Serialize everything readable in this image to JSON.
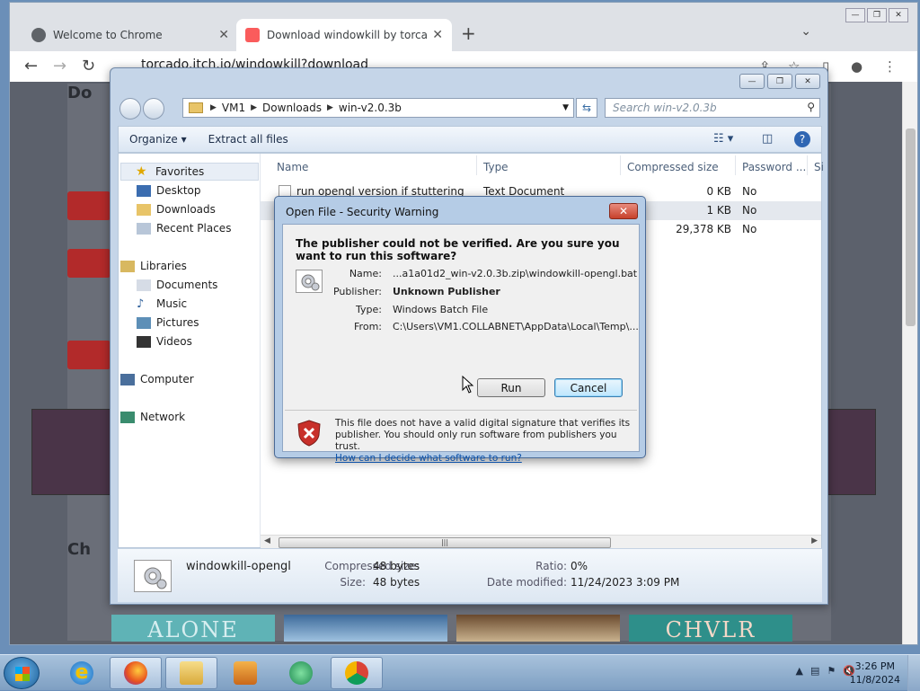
{
  "browser": {
    "tabs": [
      {
        "title": "Welcome to Chrome",
        "active": false
      },
      {
        "title": "Download windowkill by torcado",
        "active": true
      }
    ],
    "url": "torcado.itch.io/windowkill?download",
    "page_fragments": {
      "heading_top": "Do",
      "heading_bottom": "Ch",
      "thumb1": "ALONE",
      "thumb4": "CHVLR"
    }
  },
  "explorer": {
    "breadcrumb": [
      "VM1",
      "Downloads",
      "win-v2.0.3b"
    ],
    "search_placeholder": "Search win-v2.0.3b",
    "commands": {
      "organize": "Organize ▾",
      "extract": "Extract all files"
    },
    "nav": {
      "favorites": "Favorites",
      "favorites_items": [
        "Desktop",
        "Downloads",
        "Recent Places"
      ],
      "libraries": "Libraries",
      "libraries_items": [
        "Documents",
        "Music",
        "Pictures",
        "Videos"
      ],
      "computer": "Computer",
      "network": "Network"
    },
    "columns": [
      "Name",
      "Type",
      "Compressed size",
      "Password ...",
      "Si"
    ],
    "rows": [
      {
        "name": "run opengl version if stuttering",
        "type": "Text Document",
        "size": "0 KB",
        "password": "No"
      },
      {
        "name": "",
        "type": "",
        "size": "1 KB",
        "password": "No"
      },
      {
        "name": "",
        "type": "",
        "size": "29,378 KB",
        "password": "No"
      }
    ],
    "details": {
      "name": "windowkill-opengl",
      "compressed_label": "Compressed size:",
      "compressed_value": "48 bytes",
      "size_label": "Size:",
      "size_value": "48 bytes",
      "ratio_label": "Ratio:",
      "ratio_value": "0%",
      "modified_label": "Date modified:",
      "modified_value": "11/24/2023 3:09 PM"
    }
  },
  "dialog": {
    "title": "Open File - Security Warning",
    "heading": "The publisher could not be verified.  Are you sure you want to run this software?",
    "name_label": "Name:",
    "name_value": "...a1a01d2_win-v2.0.3b.zip\\windowkill-opengl.bat",
    "publisher_label": "Publisher:",
    "publisher_value": "Unknown Publisher",
    "type_label": "Type:",
    "type_value": "Windows Batch File",
    "from_label": "From:",
    "from_value": "C:\\Users\\VM1.COLLABNET\\AppData\\Local\\Temp\\...",
    "run_label": "Run",
    "cancel_label": "Cancel",
    "footer_text": "This file does not have a valid digital signature that verifies its publisher.  You should only run software from publishers you trust.",
    "footer_link": "How can I decide what software to run?"
  },
  "taskbar": {
    "time": "3:26 PM",
    "date": "11/8/2024"
  },
  "colors": {
    "accent": "#3c7fb1",
    "close_red": "#c7412b",
    "link": "#0c51a8"
  }
}
